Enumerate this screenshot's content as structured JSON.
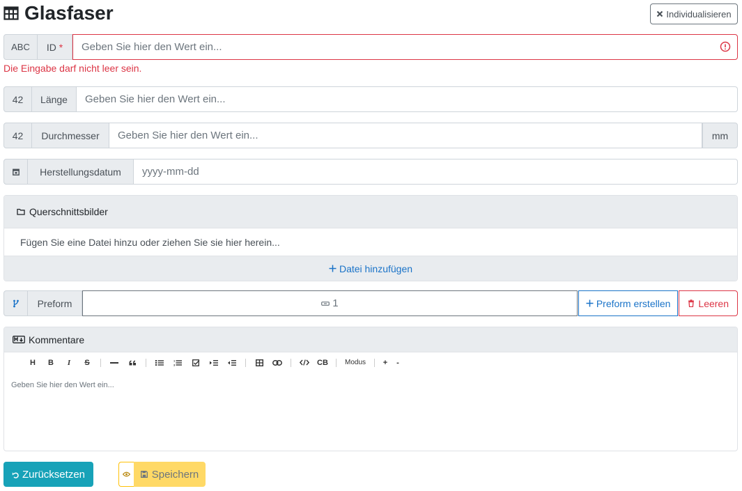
{
  "header": {
    "title": "Glasfaser",
    "customize_label": "Individualisieren"
  },
  "fields": {
    "id": {
      "type_label": "ABC",
      "label": "ID",
      "required_mark": "*",
      "placeholder": "Geben Sie hier den Wert ein...",
      "error": "Die Eingabe darf nicht leer sein."
    },
    "length": {
      "type_label": "42",
      "label": "Länge",
      "placeholder": "Geben Sie hier den Wert ein..."
    },
    "diameter": {
      "type_label": "42",
      "label": "Durchmesser",
      "placeholder": "Geben Sie hier den Wert ein...",
      "unit": "mm"
    },
    "date": {
      "label": "Herstellungsdatum",
      "placeholder": "yyyy-mm-dd"
    }
  },
  "images": {
    "title": "Querschnittsbilder",
    "drop_text": "Fügen Sie eine Datei hinzu oder ziehen Sie sie hier herein...",
    "add_label": "Datei hinzufügen"
  },
  "preform": {
    "label": "Preform",
    "value": "1",
    "create_label": "Preform erstellen",
    "clear_label": "Leeren"
  },
  "comments": {
    "title": "Kommentare",
    "toolbar": {
      "heading": "H",
      "bold": "B",
      "italic": "I",
      "strike": "S",
      "code_block": "CB",
      "mode": "Modus",
      "plus": "+",
      "minus": "-"
    },
    "placeholder": "Geben Sie hier den Wert ein..."
  },
  "actions": {
    "reset_label": "Zurücksetzen",
    "save_label": "Speichern"
  },
  "colors": {
    "danger": "#dc3545",
    "primary": "#1a73c8",
    "info": "#17a2b8",
    "warning": "#ffd966"
  }
}
